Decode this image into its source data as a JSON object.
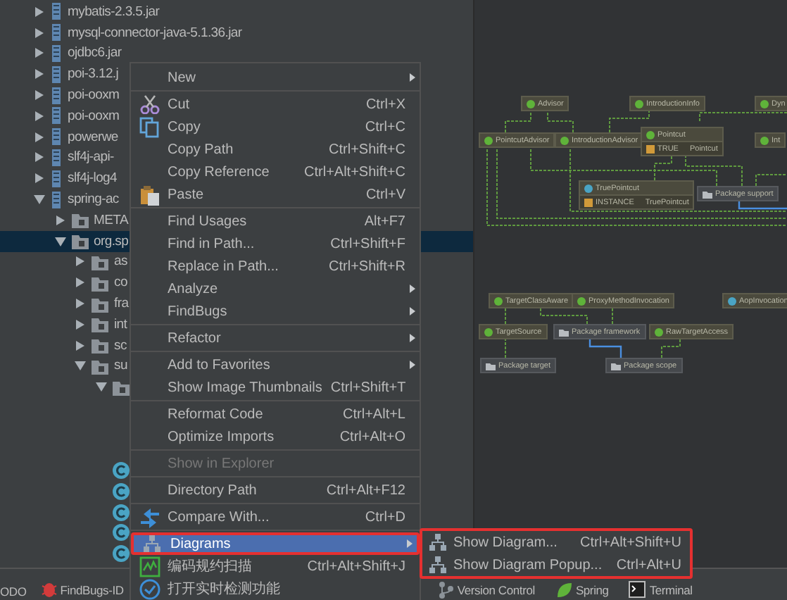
{
  "project_tree": [
    {
      "kind": "jar",
      "label": "mybatis-2.3.5.jar",
      "expanded": false
    },
    {
      "kind": "jar",
      "label": "mysql-connector-java-5.1.36.jar",
      "expanded": false
    },
    {
      "kind": "jar",
      "label": "ojdbc6.jar",
      "expanded": false
    },
    {
      "kind": "jar",
      "label": "poi-3.12.j",
      "expanded": false
    },
    {
      "kind": "jar",
      "label": "poi-ooxm",
      "expanded": false
    },
    {
      "kind": "jar",
      "label": "poi-ooxm",
      "expanded": false
    },
    {
      "kind": "jar",
      "label": "powerwe",
      "expanded": false
    },
    {
      "kind": "jar",
      "label": "slf4j-api-",
      "expanded": false
    },
    {
      "kind": "jar",
      "label": "slf4j-log4",
      "expanded": false
    },
    {
      "kind": "jar",
      "label": "spring-ac",
      "expanded": true,
      "children": [
        {
          "kind": "package",
          "label": "META",
          "expanded": false,
          "selected": false
        },
        {
          "kind": "package",
          "label": "org.sp",
          "expanded": true,
          "selected": true,
          "children": [
            {
              "kind": "package",
              "label": "as",
              "expanded": false,
              "selected": false
            },
            {
              "kind": "package",
              "label": "co",
              "expanded": false,
              "selected": false
            },
            {
              "kind": "package",
              "label": "fra",
              "expanded": false,
              "selected": false
            },
            {
              "kind": "package",
              "label": "int",
              "expanded": false,
              "selected": false
            },
            {
              "kind": "package",
              "label": "sc",
              "expanded": false,
              "selected": false
            },
            {
              "kind": "package",
              "label": "su",
              "expanded": true,
              "selected": false,
              "children": [
                {
                  "kind": "package",
                  "expanded": true,
                  "selected": false
                },
                {
                  "kind": "class",
                  "selected": false
                },
                {
                  "kind": "class",
                  "selected": false
                },
                {
                  "kind": "class",
                  "selected": false
                },
                {
                  "kind": "class",
                  "selected": false
                },
                {
                  "kind": "class",
                  "selected": false
                }
              ]
            }
          ]
        }
      ]
    }
  ],
  "diagram": {
    "nodes": [
      {
        "kind": "interface",
        "name": "Advisor"
      },
      {
        "kind": "interface",
        "name": "IntroductionInfo"
      },
      {
        "kind": "interface",
        "name": "Dyn"
      },
      {
        "kind": "interface",
        "name": "PointcutAdvisor"
      },
      {
        "kind": "interface",
        "name": "IntroductionAdvisor"
      },
      {
        "kind": "interface",
        "name": "Pointcut",
        "members": [
          {
            "name": "TRUE",
            "type": "Pointcut"
          }
        ]
      },
      {
        "kind": "interface",
        "name": "Int"
      },
      {
        "kind": "class",
        "name": "TruePointcut",
        "members": [
          {
            "name": "INSTANCE",
            "type": "TruePointcut"
          }
        ]
      },
      {
        "kind": "package",
        "name": "Package support"
      },
      {
        "kind": "interface",
        "name": "TargetClassAware"
      },
      {
        "kind": "interface",
        "name": "ProxyMethodInvocation"
      },
      {
        "kind": "class",
        "name": "AopInvocation"
      },
      {
        "kind": "interface",
        "name": "TargetSource"
      },
      {
        "kind": "package",
        "name": "Package framework"
      },
      {
        "kind": "interface",
        "name": "RawTargetAccess"
      },
      {
        "kind": "package",
        "name": "Package target"
      },
      {
        "kind": "package",
        "name": "Package scope"
      }
    ]
  },
  "context_menu": {
    "groups": [
      [
        {
          "label": "New",
          "submenu": true,
          "disabled": false,
          "selected": false
        }
      ],
      [
        {
          "label": "Cut",
          "shortcut": "Ctrl+X",
          "submenu": false,
          "disabled": false,
          "selected": false
        },
        {
          "label": "Copy",
          "shortcut": "Ctrl+C",
          "submenu": false,
          "disabled": false,
          "selected": false
        },
        {
          "label": "Copy Path",
          "shortcut": "Ctrl+Shift+C",
          "submenu": false,
          "disabled": false,
          "selected": false
        },
        {
          "label": "Copy Reference",
          "shortcut": "Ctrl+Alt+Shift+C",
          "submenu": false,
          "disabled": false,
          "selected": false
        },
        {
          "label": "Paste",
          "shortcut": "Ctrl+V",
          "submenu": false,
          "disabled": false,
          "selected": false
        }
      ],
      [
        {
          "label": "Find Usages",
          "shortcut": "Alt+F7",
          "submenu": false,
          "disabled": false,
          "selected": false
        },
        {
          "label": "Find in Path...",
          "shortcut": "Ctrl+Shift+F",
          "submenu": false,
          "disabled": false,
          "selected": false
        },
        {
          "label": "Replace in Path...",
          "shortcut": "Ctrl+Shift+R",
          "submenu": false,
          "disabled": false,
          "selected": false
        },
        {
          "label": "Analyze",
          "submenu": true,
          "disabled": false,
          "selected": false
        },
        {
          "label": "FindBugs",
          "submenu": true,
          "disabled": false,
          "selected": false
        }
      ],
      [
        {
          "label": "Refactor",
          "submenu": true,
          "disabled": false,
          "selected": false
        }
      ],
      [
        {
          "label": "Add to Favorites",
          "submenu": true,
          "disabled": false,
          "selected": false
        },
        {
          "label": "Show Image Thumbnails",
          "shortcut": "Ctrl+Shift+T",
          "submenu": false,
          "disabled": false,
          "selected": false
        }
      ],
      [
        {
          "label": "Reformat Code",
          "shortcut": "Ctrl+Alt+L",
          "submenu": false,
          "disabled": false,
          "selected": false
        },
        {
          "label": "Optimize Imports",
          "shortcut": "Ctrl+Alt+O",
          "submenu": false,
          "disabled": false,
          "selected": false
        }
      ],
      [
        {
          "label": "Show in Explorer",
          "submenu": false,
          "disabled": true,
          "selected": false
        }
      ],
      [
        {
          "label": "Directory Path",
          "shortcut": "Ctrl+Alt+F12",
          "submenu": false,
          "disabled": false,
          "selected": false
        }
      ],
      [
        {
          "label": "Compare With...",
          "shortcut": "Ctrl+D",
          "submenu": false,
          "disabled": false,
          "selected": false
        }
      ],
      [
        {
          "label": "Diagrams",
          "submenu": true,
          "disabled": false,
          "selected": true
        },
        {
          "label": "编码规约扫描",
          "shortcut": "Ctrl+Alt+Shift+J",
          "submenu": false,
          "disabled": false,
          "selected": false
        },
        {
          "label": "打开实时检测功能",
          "submenu": false,
          "disabled": false,
          "selected": false
        }
      ]
    ]
  },
  "submenu": [
    {
      "label": "Show Diagram...",
      "shortcut": "Ctrl+Alt+Shift+U"
    },
    {
      "label": "Show Diagram Popup...",
      "shortcut": "Ctrl+Alt+U"
    }
  ],
  "status_bar": [
    {
      "label": "ODO"
    },
    {
      "label": "FindBugs-ID"
    },
    {
      "label": "Version Control"
    },
    {
      "label": "Spring"
    },
    {
      "label": "Terminal"
    }
  ]
}
